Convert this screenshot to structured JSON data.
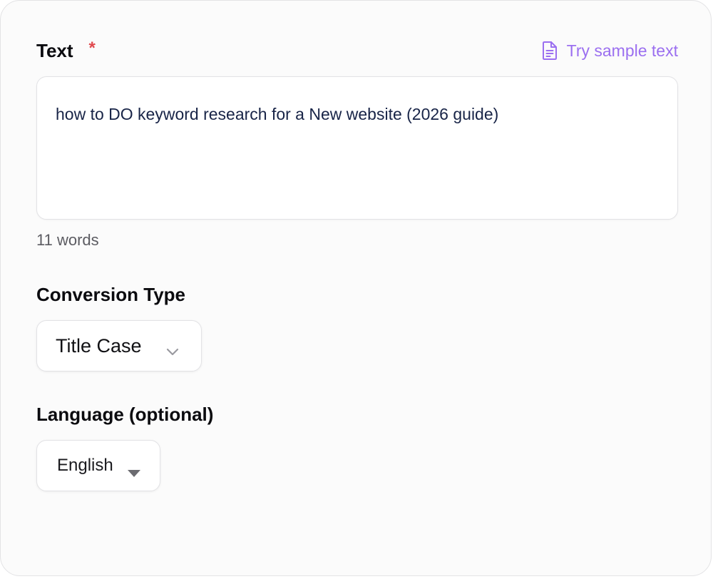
{
  "text_field": {
    "label": "Text",
    "required_marker": "*",
    "sample_button": "Try sample text",
    "value": "how to DO keyword research for a New website (2026 guide)",
    "word_count": "11 words"
  },
  "conversion": {
    "label": "Conversion Type",
    "selected": "Title Case"
  },
  "language": {
    "label": "Language (optional)",
    "selected": "English"
  },
  "icons": {
    "sample": "document-icon",
    "conversion_dropdown": "chevron-down-icon",
    "language_dropdown": "caret-down-icon"
  },
  "colors": {
    "accent": "#9b6ff0",
    "required": "#e0484d",
    "text_value": "#182447"
  }
}
